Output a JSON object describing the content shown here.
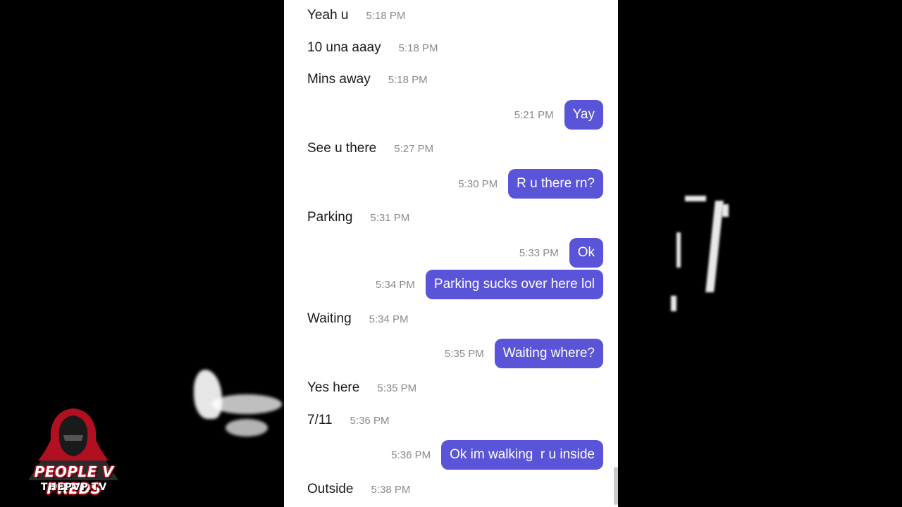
{
  "colors": {
    "background": "#000000",
    "panel": "#ffffff",
    "bubble": "#5a54d8",
    "bubble_text": "#ffffff",
    "incoming_text": "#1a1a1a",
    "timestamp": "#8a8a8a"
  },
  "messages": [
    {
      "dir": "in",
      "text": "Yeah u",
      "time": "5:18 PM"
    },
    {
      "dir": "in",
      "text": "10 una aaay",
      "time": "5:18 PM"
    },
    {
      "dir": "in",
      "text": "Mins away",
      "time": "5:18 PM"
    },
    {
      "dir": "out",
      "text": "Yay",
      "time": "5:21 PM"
    },
    {
      "dir": "in",
      "text": "See u there",
      "time": "5:27 PM"
    },
    {
      "dir": "out",
      "text": "R u there rn?",
      "time": "5:30 PM"
    },
    {
      "dir": "in",
      "text": "Parking",
      "time": "5:31 PM"
    },
    {
      "dir": "out",
      "text": "Ok",
      "time": "5:33 PM"
    },
    {
      "dir": "out",
      "text": "Parking sucks over here lol",
      "time": "5:34 PM"
    },
    {
      "dir": "in",
      "text": "Waiting",
      "time": "5:34 PM"
    },
    {
      "dir": "out",
      "text": "Waiting where?",
      "time": "5:35 PM"
    },
    {
      "dir": "in",
      "text": "Yes here",
      "time": "5:35 PM"
    },
    {
      "dir": "in",
      "text": "7/11",
      "time": "5:36 PM"
    },
    {
      "dir": "out",
      "text": "Ok im walking  r u inside",
      "time": "5:36 PM"
    },
    {
      "dir": "in",
      "text": "Outside",
      "time": "5:38 PM"
    }
  ],
  "watermark": {
    "title": "PEOPLE V PREDS",
    "subtitle": "THEPVP.TV",
    "icon": "hooded-figure-icon"
  }
}
